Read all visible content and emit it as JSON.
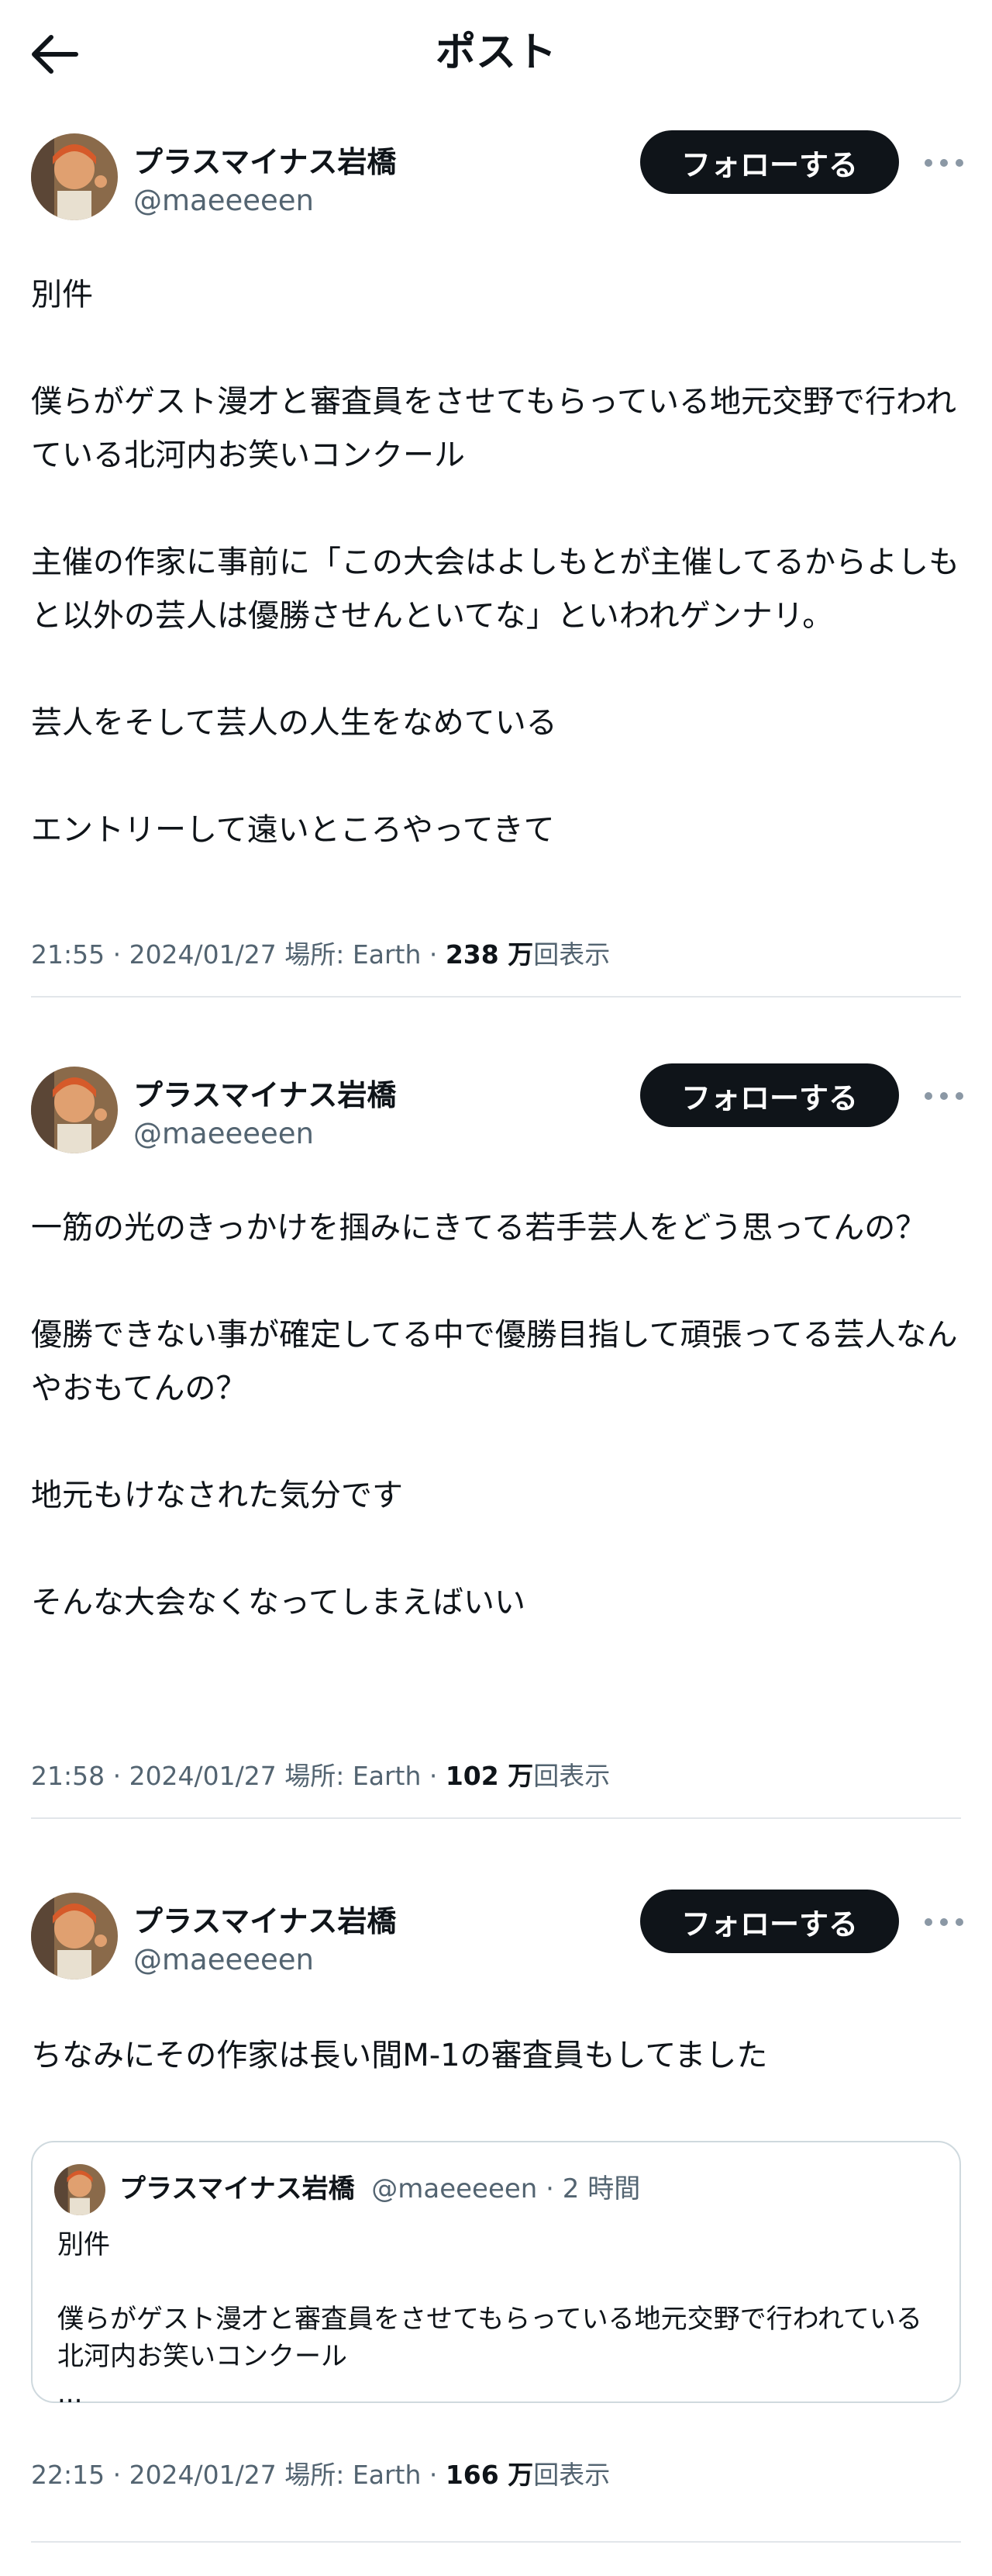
{
  "header": {
    "title": "ポスト"
  },
  "tweets": [
    {
      "author": {
        "name": "プラスマイナス岩橋",
        "handle": "@maeeeeen"
      },
      "follow_label": "フォローする",
      "paragraphs": [
        "別件",
        "僕らがゲスト漫才と審査員をさせてもらっている地元交野で行われている北河内お笑いコンクール",
        "主催の作家に事前に「この大会はよしもとが主催してるからよしもと以外の芸人は優勝させんといてな」といわれゲンナリ。",
        "芸人をそして芸人の人生をなめている",
        "エントリーして遠いところやってきて"
      ],
      "time": "21:55 · 2024/01/27 場所: Earth · ",
      "views": "238 万",
      "views_label": "回表示"
    },
    {
      "author": {
        "name": "プラスマイナス岩橋",
        "handle": "@maeeeeen"
      },
      "follow_label": "フォローする",
      "paragraphs": [
        "一筋の光のきっかけを掴みにきてる若手芸人をどう思ってんの？",
        "優勝できない事が確定してる中で優勝目指して頑張ってる芸人なんやおもてんの？",
        "地元もけなされた気分です",
        "そんな大会なくなってしまえばいい"
      ],
      "time": "21:58 · 2024/01/27 場所: Earth · ",
      "views": "102 万",
      "views_label": "回表示"
    },
    {
      "author": {
        "name": "プラスマイナス岩橋",
        "handle": "@maeeeeen"
      },
      "follow_label": "フォローする",
      "paragraphs": [
        "ちなみにその作家は長い間M-1の審査員もしてました"
      ],
      "quote": {
        "name": "プラスマイナス岩橋",
        "handle_time": "@maeeeeen · 2 時間",
        "paragraphs": [
          "別件",
          "僕らがゲスト漫才と審査員をさせてもらっている地元交野で行われている北河内お笑いコンクール",
          "..."
        ]
      },
      "time": "22:15 · 2024/01/27 場所: Earth · ",
      "views": "166 万",
      "views_label": "回表示"
    }
  ],
  "colors": {
    "text": "#0f1419",
    "secondary": "#536471",
    "follow_button_bg": "#0f1419",
    "divider": "#e2e6ea",
    "quote_border": "#cfd9de"
  }
}
